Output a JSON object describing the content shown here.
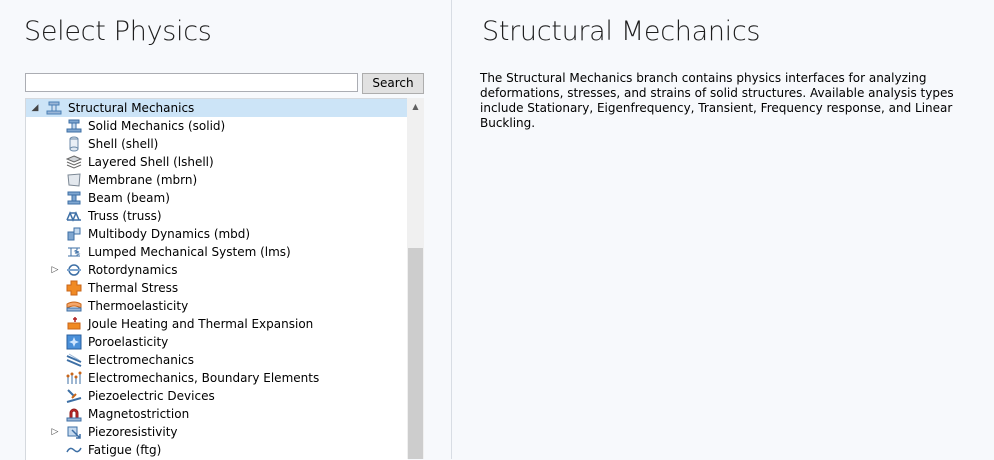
{
  "left": {
    "title": "Select Physics",
    "search": {
      "value": "",
      "placeholder": "",
      "button_label": "Search"
    },
    "tree": [
      {
        "label": "Structural Mechanics",
        "level": 0,
        "expander": "expanded",
        "selected": true,
        "icon": "structural-mechanics-icon"
      },
      {
        "label": "Solid Mechanics (solid)",
        "level": 1,
        "expander": "none",
        "icon": "solid-mechanics-icon"
      },
      {
        "label": "Shell (shell)",
        "level": 1,
        "expander": "none",
        "icon": "shell-icon"
      },
      {
        "label": "Layered Shell (lshell)",
        "level": 1,
        "expander": "none",
        "icon": "layered-shell-icon"
      },
      {
        "label": "Membrane (mbrn)",
        "level": 1,
        "expander": "none",
        "icon": "membrane-icon"
      },
      {
        "label": "Beam (beam)",
        "level": 1,
        "expander": "none",
        "icon": "beam-icon"
      },
      {
        "label": "Truss (truss)",
        "level": 1,
        "expander": "none",
        "icon": "truss-icon"
      },
      {
        "label": "Multibody Dynamics (mbd)",
        "level": 1,
        "expander": "none",
        "icon": "multibody-dynamics-icon"
      },
      {
        "label": "Lumped Mechanical System (lms)",
        "level": 1,
        "expander": "none",
        "icon": "lumped-mechanical-system-icon"
      },
      {
        "label": "Rotordynamics",
        "level": 1,
        "expander": "collapsed",
        "icon": "rotordynamics-icon"
      },
      {
        "label": "Thermal Stress",
        "level": 1,
        "expander": "none",
        "icon": "thermal-stress-icon"
      },
      {
        "label": "Thermoelasticity",
        "level": 1,
        "expander": "none",
        "icon": "thermoelasticity-icon"
      },
      {
        "label": "Joule Heating and Thermal Expansion",
        "level": 1,
        "expander": "none",
        "icon": "joule-heating-icon"
      },
      {
        "label": "Poroelasticity",
        "level": 1,
        "expander": "none",
        "icon": "poroelasticity-icon"
      },
      {
        "label": "Electromechanics",
        "level": 1,
        "expander": "none",
        "icon": "electromechanics-icon"
      },
      {
        "label": "Electromechanics, Boundary Elements",
        "level": 1,
        "expander": "none",
        "icon": "electromechanics-boundary-elements-icon"
      },
      {
        "label": "Piezoelectric Devices",
        "level": 1,
        "expander": "none",
        "icon": "piezoelectric-devices-icon"
      },
      {
        "label": "Magnetostriction",
        "level": 1,
        "expander": "none",
        "icon": "magnetostriction-icon"
      },
      {
        "label": "Piezoresistivity",
        "level": 1,
        "expander": "collapsed",
        "icon": "piezoresistivity-icon"
      },
      {
        "label": "Fatigue (ftg)",
        "level": 1,
        "expander": "none",
        "icon": "fatigue-icon"
      }
    ]
  },
  "right": {
    "title": "Structural Mechanics",
    "description": "The Structural Mechanics branch contains physics interfaces for analyzing deformations, stresses, and strains of solid structures. Available analysis types include Stationary, Eigenfrequency, Transient, Frequency response, and Linear Buckling."
  },
  "colors": {
    "selection": "#cce4f7",
    "pane_background": "#f7f9fc",
    "accent_orange": "#f08a24",
    "icon_blue": "#4a7fb5"
  }
}
